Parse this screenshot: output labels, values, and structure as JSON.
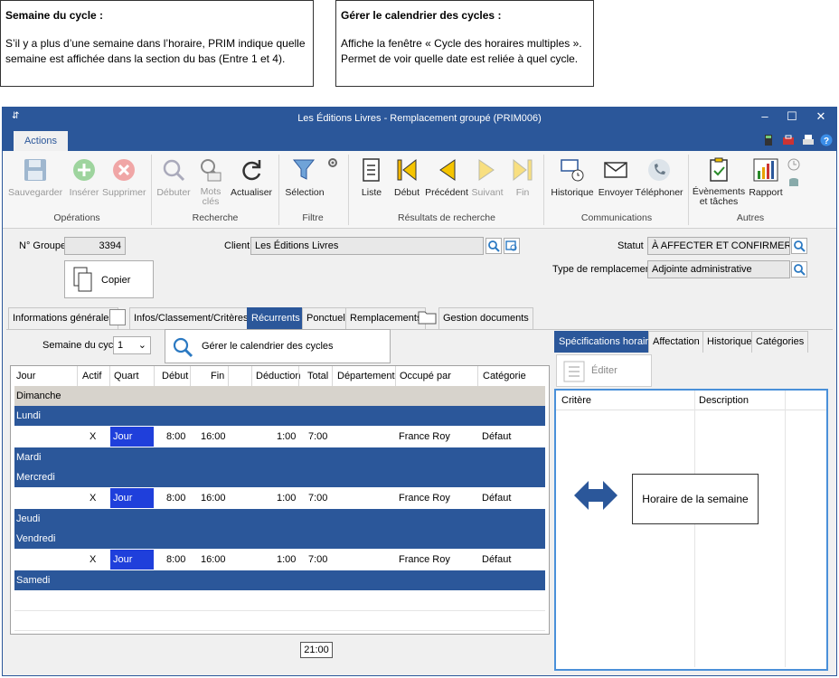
{
  "callouts": [
    {
      "title": "Semaine du cycle :",
      "text": "S’il y a plus d’une semaine dans l’horaire, PRIM indique quelle semaine est affichée dans la section du bas (Entre 1 et 4)."
    },
    {
      "title": "Gérer le calendrier des cycles :",
      "text": "Affiche la fenêtre « Cycle des horaires multiples ». Permet de voir quelle date est reliée à quel cycle."
    }
  ],
  "window": {
    "title": "Les Éditions Livres - Remplacement groupé (PRIM006)",
    "controls": {
      "minimize": "–",
      "maximize": "☐",
      "close": "✕"
    }
  },
  "ribbon": {
    "tab": "Actions",
    "buttons": {
      "sauvegarder": "Sauvegarder",
      "inserer": "Insérer",
      "supprimer": "Supprimer",
      "debuter": "Débuter",
      "mots1": "Mots",
      "mots2": "clés",
      "actualiser": "Actualiser",
      "selection": "Sélection",
      "liste": "Liste",
      "debut": "Début",
      "precedent": "Précédent",
      "suivant": "Suivant",
      "fin": "Fin",
      "historique": "Historique",
      "envoyer": "Envoyer",
      "telephoner": "Téléphoner",
      "evenements1": "Évènements",
      "evenements2": "et tâches",
      "rapport": "Rapport"
    },
    "groups": {
      "operations": "Opérations",
      "recherche": "Recherche",
      "filtre": "Filtre",
      "resultats": "Résultats de recherche",
      "communications": "Communications",
      "autres": "Autres"
    }
  },
  "form": {
    "groupe_label": "N° Groupe",
    "groupe_value": "3394",
    "client_label": "Client",
    "client_value": "Les Éditions Livres",
    "statut_label": "Statut",
    "statut_value": "À AFFECTER ET CONFIRMER",
    "type_label": "Type de remplacement",
    "type_value": "Adjointe administrative",
    "copier": "Copier"
  },
  "tabs": [
    "Informations générales",
    "Infos/Classement/Critères",
    "Récurrents",
    "Ponctuel",
    "Remplacements",
    "Gestion documents"
  ],
  "cycle": {
    "label": "Semaine du cycle",
    "value": "1",
    "manage_button": "Gérer le calendrier des cycles"
  },
  "grid": {
    "headers": [
      "Jour",
      "Actif",
      "Quart",
      "Début",
      "Fin",
      "Déduction",
      "Total",
      "Département",
      "Occupé par",
      "Catégorie"
    ],
    "days": [
      "Dimanche",
      "Lundi",
      "Mardi",
      "Mercredi",
      "Jeudi",
      "Vendredi",
      "Samedi"
    ],
    "shift": {
      "actif": "X",
      "quart": "Jour",
      "debut": "8:00",
      "fin": "16:00",
      "deduction": "1:00",
      "total": "7:00",
      "occupe": "France Roy",
      "categorie": "Défaut"
    },
    "total": "21:00"
  },
  "right": {
    "tabs": [
      "Spécifications horaire",
      "Affectation",
      "Historique",
      "Catégories"
    ],
    "edit_button": "Éditer",
    "headers": [
      "Critère",
      "Description"
    ],
    "annotation": "Horaire de la semaine"
  },
  "colors": {
    "accent": "#2b579a",
    "selected_cell": "#1f3fdb"
  }
}
